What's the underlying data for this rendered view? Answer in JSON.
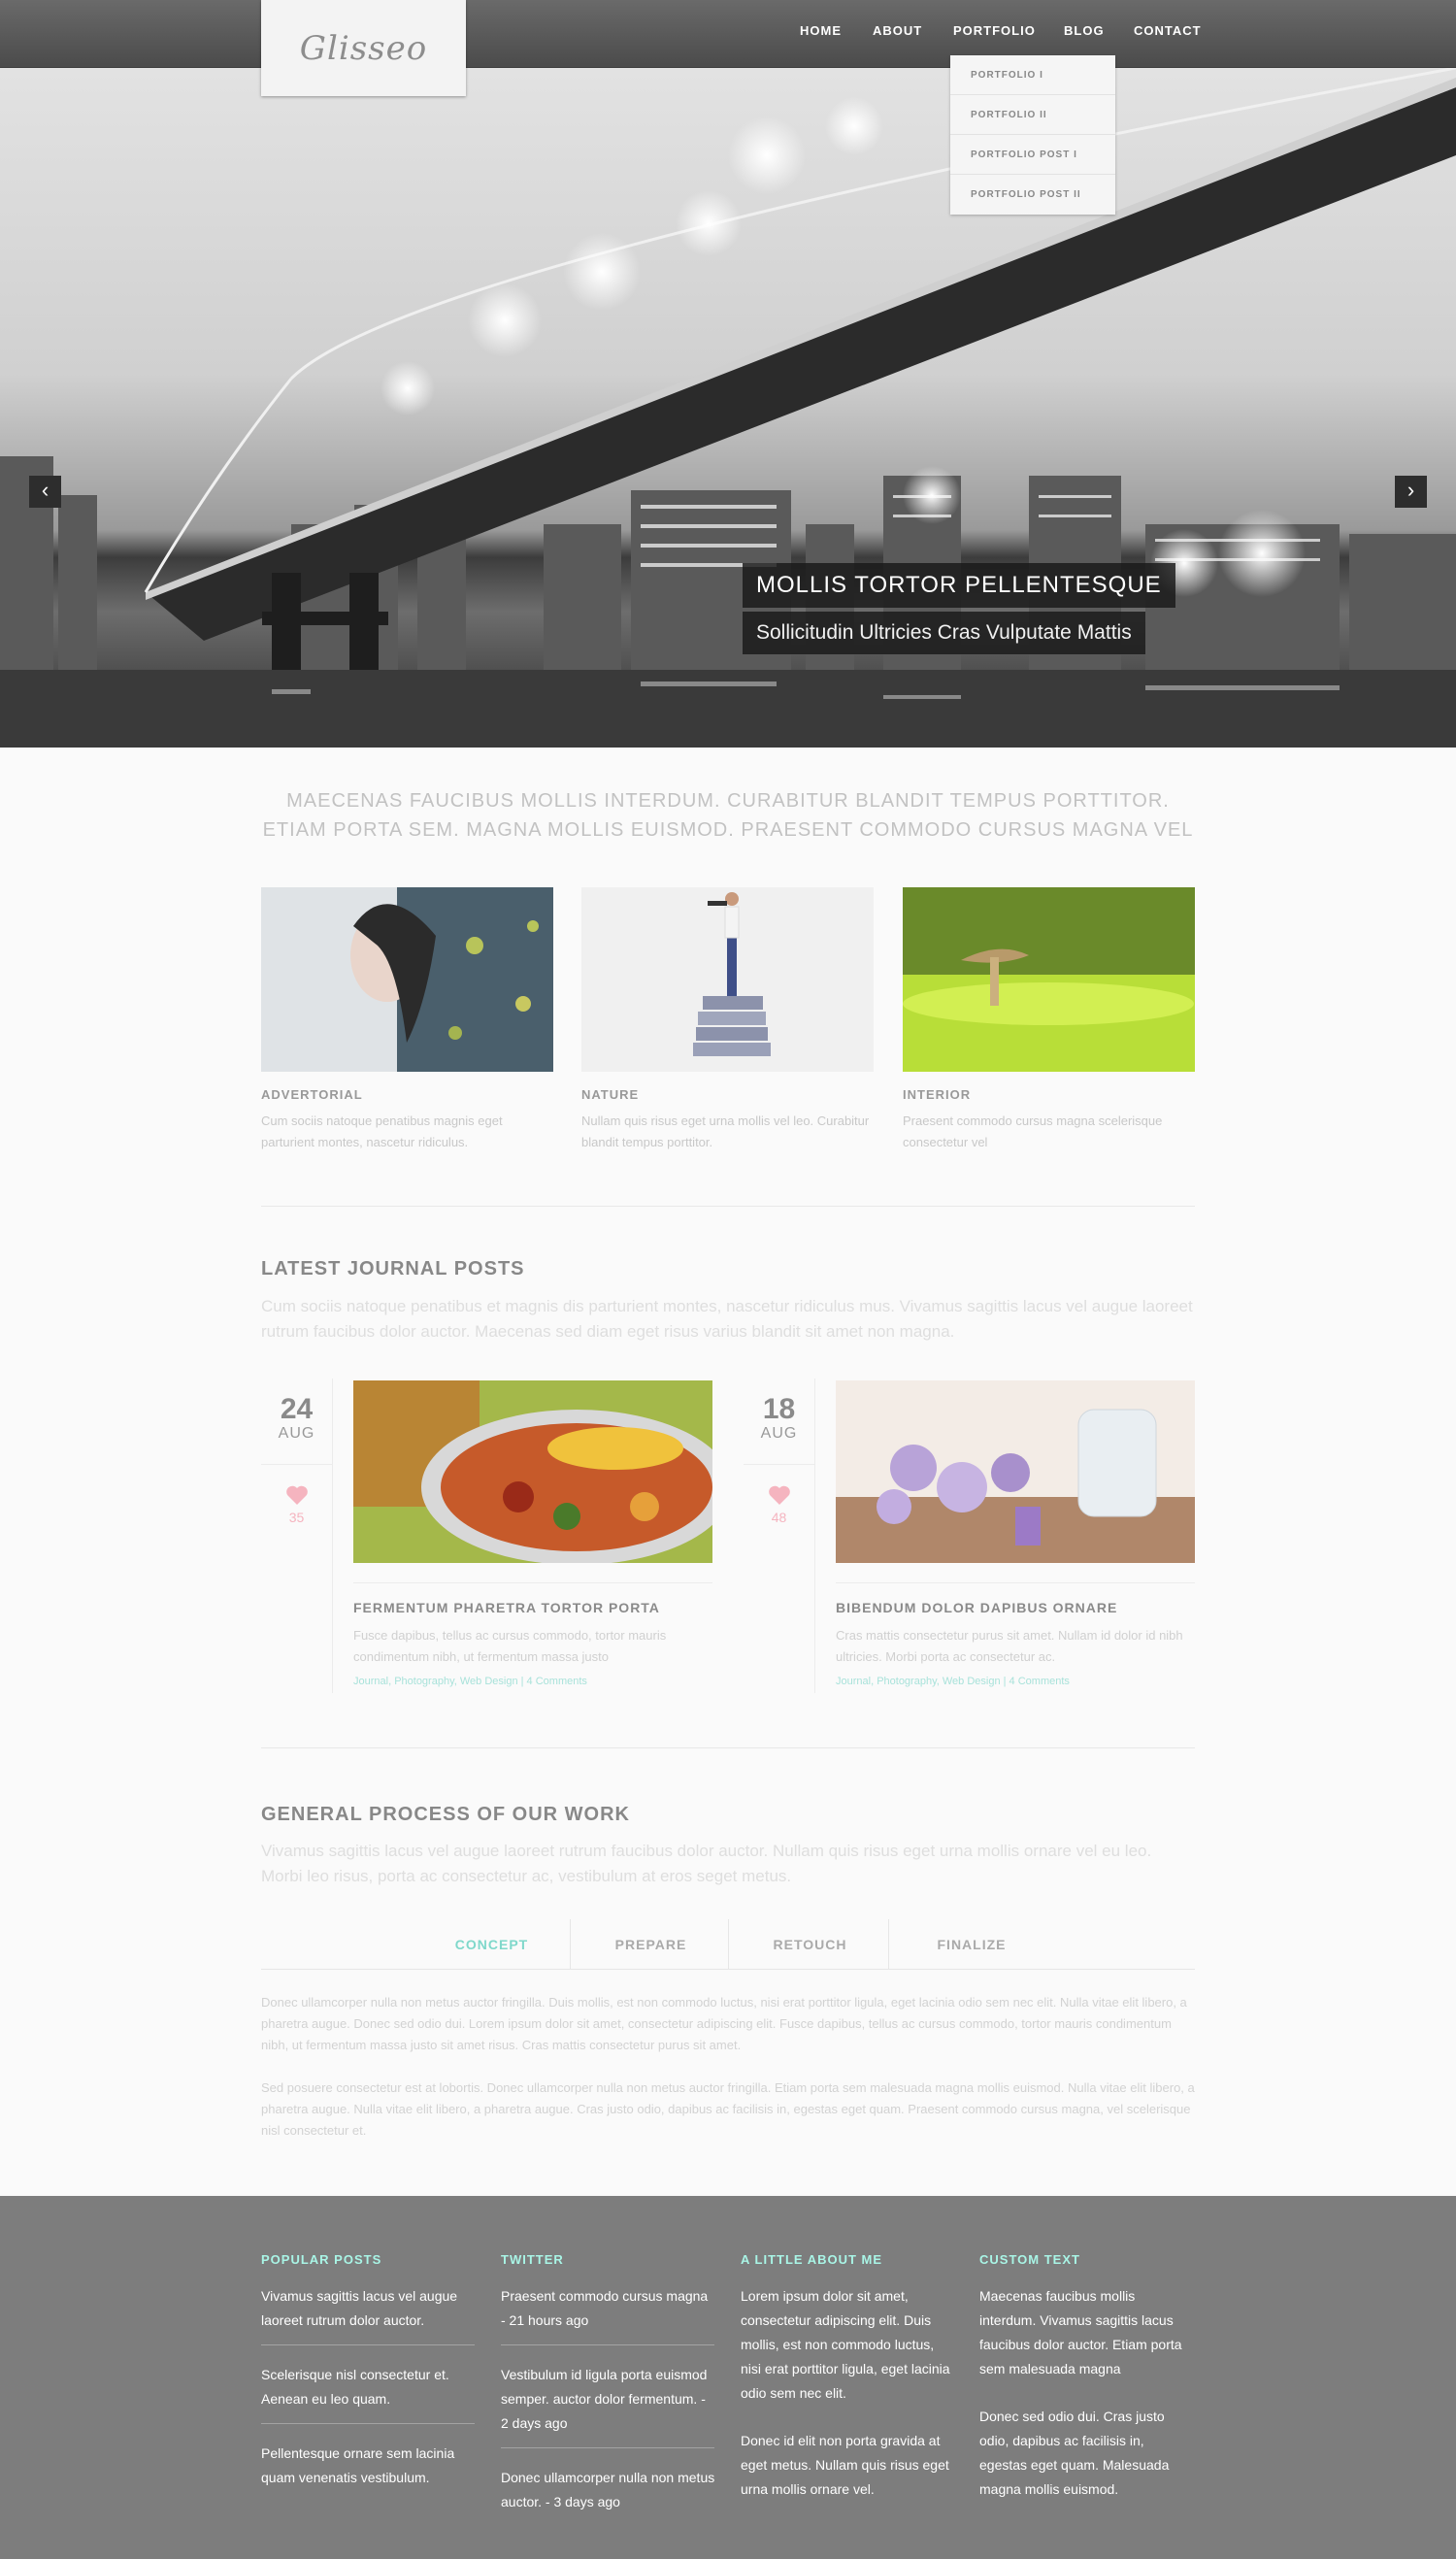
{
  "site": {
    "logo": "Glisseo"
  },
  "nav": {
    "items": [
      "HOME",
      "ABOUT",
      "PORTFOLIO",
      "BLOG",
      "CONTACT"
    ],
    "dropdown": [
      "PORTFOLIO I",
      "PORTFOLIO II",
      "PORTFOLIO POST I",
      "PORTFOLIO POST II"
    ]
  },
  "hero": {
    "caption_title": "MOLLIS TORTOR PELLENTESQUE",
    "caption_sub": "Sollicitudin Ultricies Cras Vulputate Mattis"
  },
  "intro": "MAECENAS FAUCIBUS MOLLIS INTERDUM. CURABITUR BLANDIT TEMPUS PORTTITOR. ETIAM PORTA SEM. MAGNA MOLLIS EUISMOD. PRAESENT COMMODO CURSUS MAGNA VEL",
  "features": [
    {
      "title": "ADVERTORIAL",
      "text": "Cum sociis natoque penatibus magnis eget parturient montes, nascetur ridiculus."
    },
    {
      "title": "NATURE",
      "text": "Nullam quis risus eget urna mollis vel leo. Curabitur blandit tempus porttitor."
    },
    {
      "title": "INTERIOR",
      "text": "Praesent commodo cursus magna scelerisque consectetur vel"
    }
  ],
  "journal": {
    "title": "LATEST JOURNAL POSTS",
    "desc": "Cum sociis natoque penatibus et magnis dis parturient montes, nascetur ridiculus mus. Vivamus sagittis lacus vel augue laoreet rutrum faucibus dolor auctor. Maecenas sed diam eget risus varius blandit sit amet non magna.",
    "posts": [
      {
        "day": "24",
        "month": "AUG",
        "likes": "35",
        "title": "FERMENTUM PHARETRA TORTOR PORTA",
        "text": "Fusce dapibus, tellus ac cursus commodo, tortor mauris condimentum nibh, ut fermentum massa justo",
        "meta": "Journal, Photography, Web Design | 4 Comments"
      },
      {
        "day": "18",
        "month": "AUG",
        "likes": "48",
        "title": "BIBENDUM DOLOR DAPIBUS ORNARE",
        "text": "Cras mattis consectetur purus sit amet. Nullam id dolor id nibh ultricies. Morbi porta ac consectetur ac.",
        "meta": "Journal, Photography, Web Design | 4 Comments"
      }
    ]
  },
  "process": {
    "title": "GENERAL PROCESS OF OUR WORK",
    "desc": "Vivamus sagittis lacus vel augue laoreet rutrum faucibus dolor auctor. Nullam quis risus eget urna mollis ornare vel eu leo. Morbi leo risus, porta ac consectetur ac, vestibulum at eros seget metus.",
    "tabs": [
      "CONCEPT",
      "PREPARE",
      "RETOUCH",
      "FINALIZE"
    ],
    "para1": "Donec ullamcorper nulla non metus auctor fringilla. Duis mollis, est non commodo luctus, nisi erat porttitor ligula, eget lacinia odio sem nec elit. Nulla vitae elit libero, a pharetra augue. Donec sed odio dui. Lorem ipsum dolor sit amet, consectetur adipiscing elit. Fusce dapibus, tellus ac cursus commodo, tortor mauris condimentum nibh, ut fermentum massa justo sit amet risus. Cras mattis consectetur purus sit amet.",
    "para2": "Sed posuere consectetur est at lobortis. Donec ullamcorper nulla non metus auctor fringilla. Etiam porta sem malesuada magna mollis euismod. Nulla vitae elit libero, a pharetra augue. Nulla vitae elit libero, a pharetra augue. Cras justo odio, dapibus ac facilisis in, egestas eget quam. Praesent commodo cursus magna, vel scelerisque nisl consectetur et."
  },
  "footer": {
    "popular": {
      "title": "POPULAR POSTS",
      "items": [
        "Vivamus sagittis lacus vel augue laoreet rutrum dolor auctor.",
        "Scelerisque nisl consectetur et. Aenean eu leo quam.",
        "Pellentesque ornare sem lacinia quam venenatis vestibulum."
      ]
    },
    "twitter": {
      "title": "TWITTER",
      "items": [
        "Praesent commodo cursus magna - 21 hours ago",
        "Vestibulum id ligula porta euismod semper. auctor dolor fermentum. - 2 days ago",
        "Donec ullamcorper nulla non metus auctor. - 3 days ago"
      ]
    },
    "about": {
      "title": "A LITTLE ABOUT ME",
      "p1": "Lorem ipsum dolor sit amet, consectetur adipiscing elit. Duis mollis, est non commodo luctus, nisi erat porttitor ligula, eget lacinia odio sem nec elit.",
      "p2": "Donec id elit non porta gravida at eget metus. Nullam quis risus eget urna mollis ornare vel."
    },
    "custom": {
      "title": "CUSTOM TEXT",
      "p1": "Maecenas faucibus mollis interdum. Vivamus sagittis lacus faucibus dolor auctor. Etiam porta sem malesuada magna",
      "p2": "Donec sed odio dui. Cras justo odio, dapibus ac facilisis in, egestas eget quam. Malesuada magna mollis euismod."
    }
  },
  "colors": {
    "accent": "#7fd8cb",
    "footer_heading": "#a9f5e6",
    "heart": "#f5b4bf",
    "footer_bg": "#7d7d7d"
  }
}
